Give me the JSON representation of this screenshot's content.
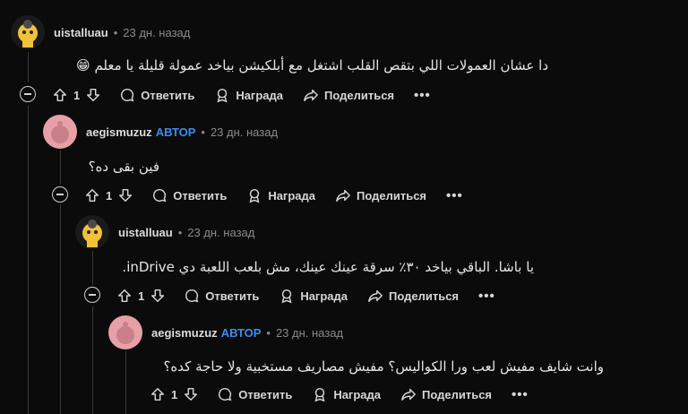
{
  "comments": [
    {
      "username": "uistalluau",
      "op_badge": "",
      "dot": "•",
      "time": "23 дн. назад",
      "text": "دا عشان العمولات اللي بتقص القلب اشتغل مع أبلكيشن بياخد عمولة قليلة يا معلم 😁",
      "votes": "1",
      "avatar_color": "#f0c23a"
    },
    {
      "username": "aegismuzuz",
      "op_badge": "АВТОР",
      "dot": "•",
      "time": "23 дн. назад",
      "text": "فين بقى ده؟",
      "votes": "1",
      "avatar_color": "#e8a0a8"
    },
    {
      "username": "uistalluau",
      "op_badge": "",
      "dot": "•",
      "time": "23 дн. назад",
      "text": "يا باشا. الباقي بياخد ٣٠٪ سرقة عينك عينك، مش بلعب اللعبة دي inDrive.",
      "votes": "1",
      "avatar_color": "#f0c23a"
    },
    {
      "username": "aegismuzuz",
      "op_badge": "АВТОР",
      "dot": "•",
      "time": "23 дн. назад",
      "text": "وانت شايف مفيش لعب ورا الكواليس؟ مفيش مصاريف مستخبية ولا حاجة كده؟",
      "votes": "1",
      "avatar_color": "#e8a0a8"
    }
  ],
  "actions": {
    "reply": "Ответить",
    "award": "Награда",
    "share": "Поделиться",
    "more": "•••"
  }
}
